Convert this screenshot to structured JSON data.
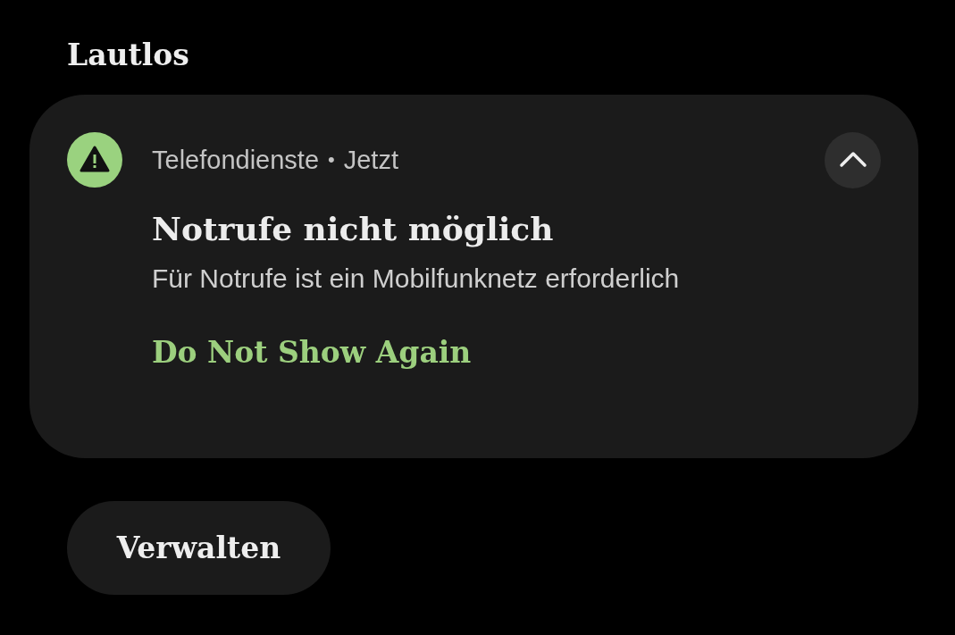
{
  "section_title": "Lautlos",
  "notification": {
    "app": "Telefondienste",
    "separator": "•",
    "time": "Jetzt",
    "expanded": true,
    "title": "Notrufe nicht möglich",
    "body": "Für Notrufe ist ein Mobilfunknetz erforderlich",
    "actions": [
      "Do Not Show Again"
    ]
  },
  "manage_button": "Verwalten"
}
